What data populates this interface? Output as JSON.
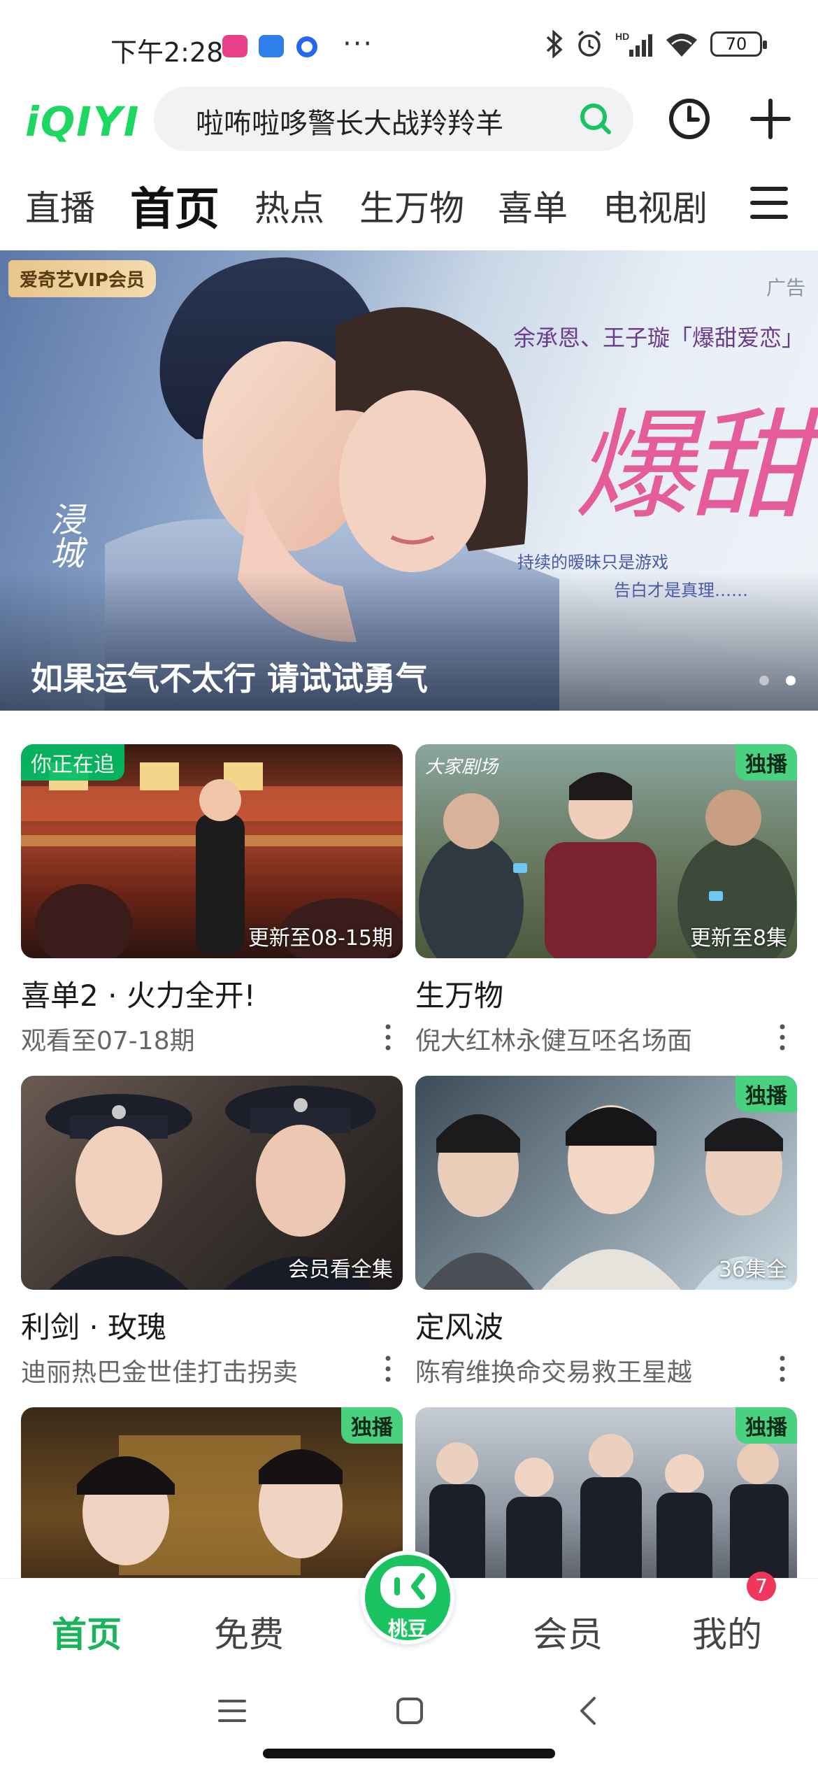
{
  "status_bar": {
    "time": "下午2:28",
    "dots": "···",
    "battery": "70"
  },
  "header": {
    "logo": "iQIYI",
    "search_text": "啦咘啦哆警长大战羚羚羊"
  },
  "tabs": [
    {
      "label": "直播"
    },
    {
      "label": "首页"
    },
    {
      "label": "热点"
    },
    {
      "label": "生万物"
    },
    {
      "label": "喜单"
    },
    {
      "label": "电视剧"
    }
  ],
  "banner": {
    "vip_tag": "爱奇艺VIP会员",
    "ad_label": "广告",
    "cast_line": "余承恩、王子璇「爆甜爱恋」",
    "title_art": "爆甜",
    "tagline_1": "持续的暧昧只是游戏",
    "tagline_2": "告白才是真理……",
    "logo_text": "浸城",
    "caption": "如果运气不太行 请试试勇气"
  },
  "cards": [
    {
      "title": "喜单2 · 火力全开!",
      "subtitle": "观看至07-18期",
      "badge_left": "你正在追",
      "badge_right": "",
      "status": "更新至08-15期"
    },
    {
      "title": "生万物",
      "subtitle": "倪大红林永健互呸名场面",
      "badge_left": "",
      "badge_right": "独播",
      "status": "更新至8集",
      "overlay_text": "大家剧场"
    },
    {
      "title": "利剑 · 玫瑰",
      "subtitle": "迪丽热巴金世佳打击拐卖",
      "badge_left": "",
      "badge_right": "",
      "status": "会员看全集"
    },
    {
      "title": "定风波",
      "subtitle": "陈宥维换命交易救王星越",
      "badge_left": "",
      "badge_right": "独播",
      "status": "36集全"
    },
    {
      "title": "",
      "subtitle": "",
      "badge_left": "",
      "badge_right": "独播",
      "status": ""
    },
    {
      "title": "",
      "subtitle": "",
      "badge_left": "",
      "badge_right": "独播",
      "status": ""
    }
  ],
  "bottom_nav": {
    "home": "首页",
    "free": "免费",
    "taodou": "桃豆",
    "vip": "会员",
    "mine": "我的",
    "mine_badge": "7"
  },
  "colors": {
    "brand_green": "#19b35a",
    "badge_green": "#49d17f",
    "notify_red": "#f0365a"
  },
  "icons": [
    "search-icon",
    "history-clock-icon",
    "plus-icon",
    "menu-icon",
    "more-vertical-icon",
    "bluetooth-icon",
    "alarm-icon",
    "signal-icon",
    "wifi-icon",
    "battery-icon"
  ]
}
